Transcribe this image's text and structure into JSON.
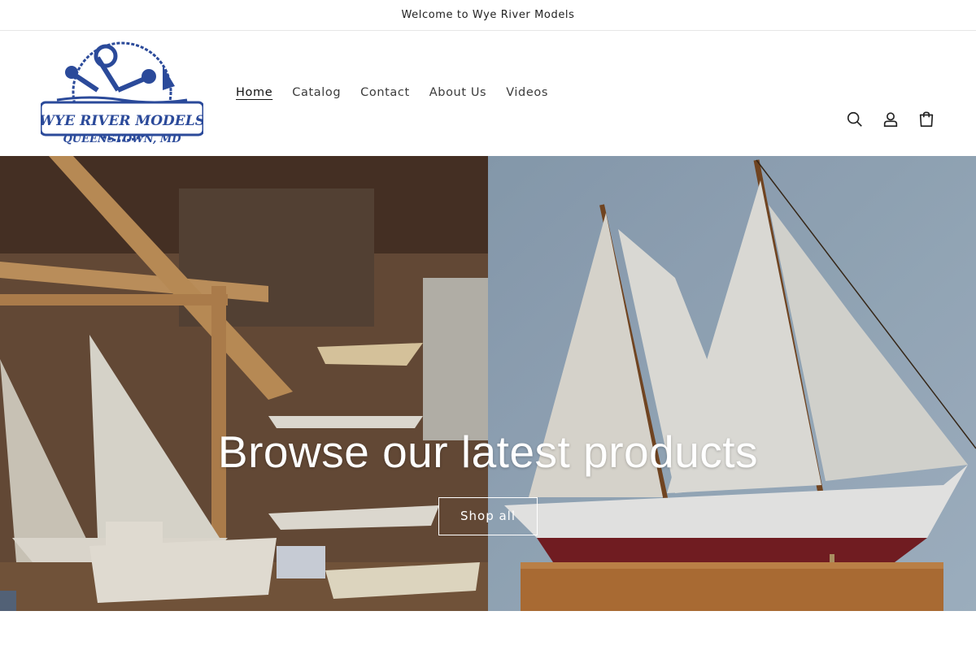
{
  "announcement": {
    "text": "Welcome to Wye River Models"
  },
  "brand": {
    "logo_top": "WYE RIVER MODELS",
    "logo_bottom": "QUEENSTOWN, MD",
    "color": "#2b4a9a"
  },
  "nav": {
    "items": [
      {
        "label": "Home",
        "active": true
      },
      {
        "label": "Catalog"
      },
      {
        "label": "Contact"
      },
      {
        "label": "About Us"
      },
      {
        "label": "Videos"
      }
    ]
  },
  "header_icons": [
    "search-icon",
    "account-icon",
    "cart-icon"
  ],
  "hero": {
    "title": "Browse our latest products",
    "button_label": "Shop all"
  }
}
